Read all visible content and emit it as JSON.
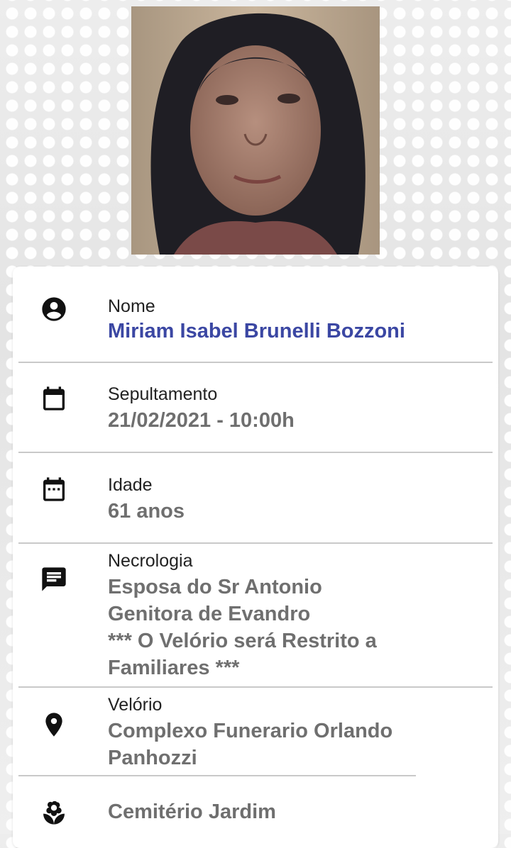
{
  "photo": {
    "description_icon": "portrait-photo"
  },
  "fields": {
    "nome": {
      "icon": "account-circle-icon",
      "label": "Nome",
      "value": "Miriam Isabel Brunelli Bozzoni"
    },
    "sepultamento": {
      "icon": "calendar-icon",
      "label": "Sepultamento",
      "value": "21/02/2021 - 10:00h"
    },
    "idade": {
      "icon": "calendar-dots-icon",
      "label": "Idade",
      "value": "61 anos"
    },
    "necrologia": {
      "icon": "message-icon",
      "label": "Necrologia",
      "lines": [
        "Esposa do Sr Antonio",
        "Genitora de Evandro",
        "*** O Velório será Restrito a",
        "Familiares ***"
      ]
    },
    "velorio": {
      "icon": "location-pin-icon",
      "label": "Velório",
      "lines": [
        "Complexo Funerario Orlando",
        "Panhozzi"
      ]
    },
    "cemiterio": {
      "icon": "flower-icon",
      "value": "Cemitério Jardim"
    }
  },
  "colors": {
    "name": "#3b47a3",
    "value": "#6f6f6f",
    "icon": "#111111"
  }
}
